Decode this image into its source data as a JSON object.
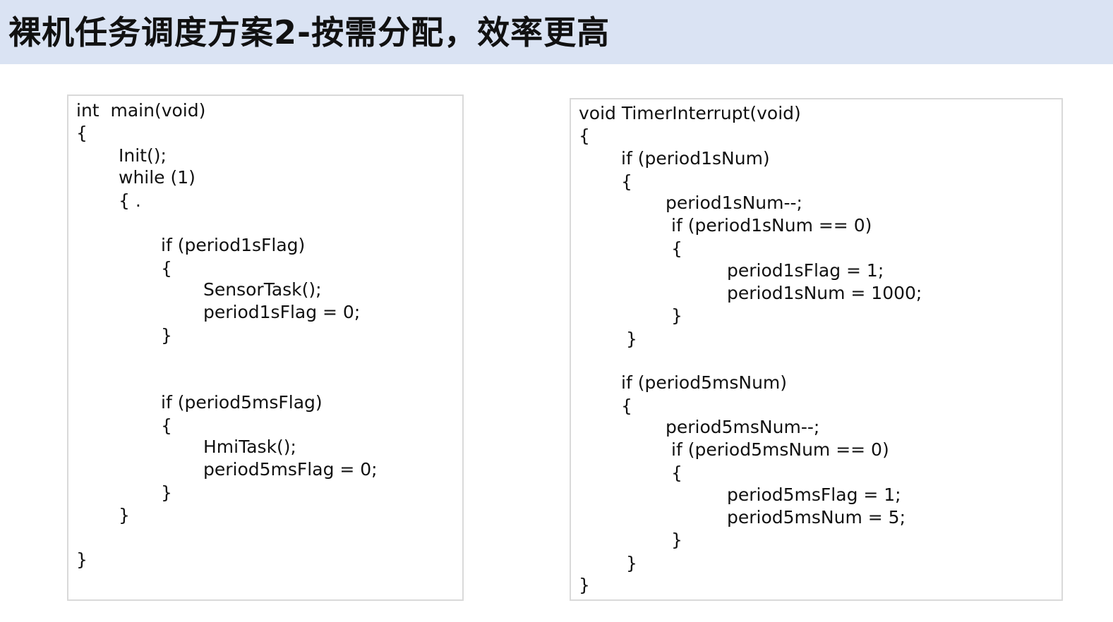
{
  "slide": {
    "title": "裸机任务调度方案2-按需分配，效率更高"
  },
  "left_code": {
    "lines": [
      "int  main(void)",
      "{",
      "Init();",
      "while (1)",
      "{ .",
      "if (period1sFlag)",
      "{",
      "SensorTask();",
      "period1sFlag = 0;",
      "}",
      "if (period5msFlag)",
      "{",
      "HmiTask();",
      "period5msFlag = 0;",
      "}",
      "}",
      "}"
    ]
  },
  "right_code": {
    "lines": [
      "void TimerInterrupt(void)",
      "{",
      "if (period1sNum)",
      "{",
      "period1sNum--;",
      "if (period1sNum == 0)",
      "{",
      "period1sFlag = 1;",
      "period1sNum = 1000;",
      "}",
      "}",
      "if (period5msNum)",
      "{",
      "period5msNum--;",
      "if (period5msNum == 0)",
      "{",
      "period5msFlag = 1;",
      "period5msNum = 5;",
      "}",
      "}",
      "}"
    ]
  }
}
